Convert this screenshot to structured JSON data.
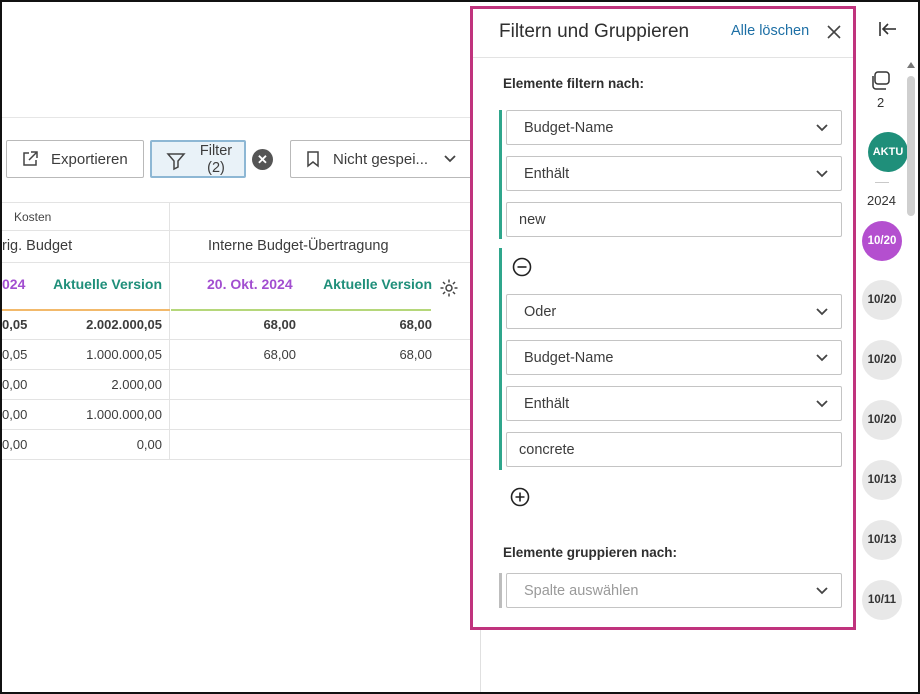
{
  "toolbar": {
    "export_label": "Exportieren",
    "filter_label": "Filter",
    "filter_count": "(2)",
    "view_label": "Nicht gespei..."
  },
  "table": {
    "group_label": "Kosten",
    "col_group_1": "rig. Budget",
    "col_group_2": "Interne Budget-Übertragung",
    "headers": [
      "024",
      "Aktuelle Version",
      "20. Okt. 2024",
      "Aktuelle Version"
    ],
    "rows": [
      [
        "0,05",
        "2.002.000,05",
        "68,00",
        "68,00"
      ],
      [
        "0,05",
        "1.000.000,05",
        "68,00",
        "68,00"
      ],
      [
        "0,00",
        "2.000,00",
        "",
        ""
      ],
      [
        "0,00",
        "1.000.000,00",
        "",
        ""
      ],
      [
        "0,00",
        "0,00",
        "",
        ""
      ]
    ]
  },
  "panel": {
    "title": "Filtern und Gruppieren",
    "clear_all": "Alle löschen",
    "filter_section": "Elemente filtern nach:",
    "filter1": {
      "field": "Budget-Name",
      "operator": "Enthält",
      "value": "new"
    },
    "combinator": "Oder",
    "filter2": {
      "field": "Budget-Name",
      "operator": "Enthält",
      "value": "concrete"
    },
    "group_section": "Elemente gruppieren nach:",
    "group_placeholder": "Spalte auswählen"
  },
  "timeline": {
    "count": "2",
    "current_label": "AKTU",
    "year": "2024",
    "entries": [
      "10/20",
      "10/20",
      "10/20",
      "10/20",
      "10/13",
      "10/13",
      "10/11"
    ]
  },
  "colors": {
    "panel_border": "#c0337d",
    "accent_teal": "#1f8f7a",
    "accent_purple": "#a24ed0",
    "link_blue": "#1d6fa5"
  }
}
